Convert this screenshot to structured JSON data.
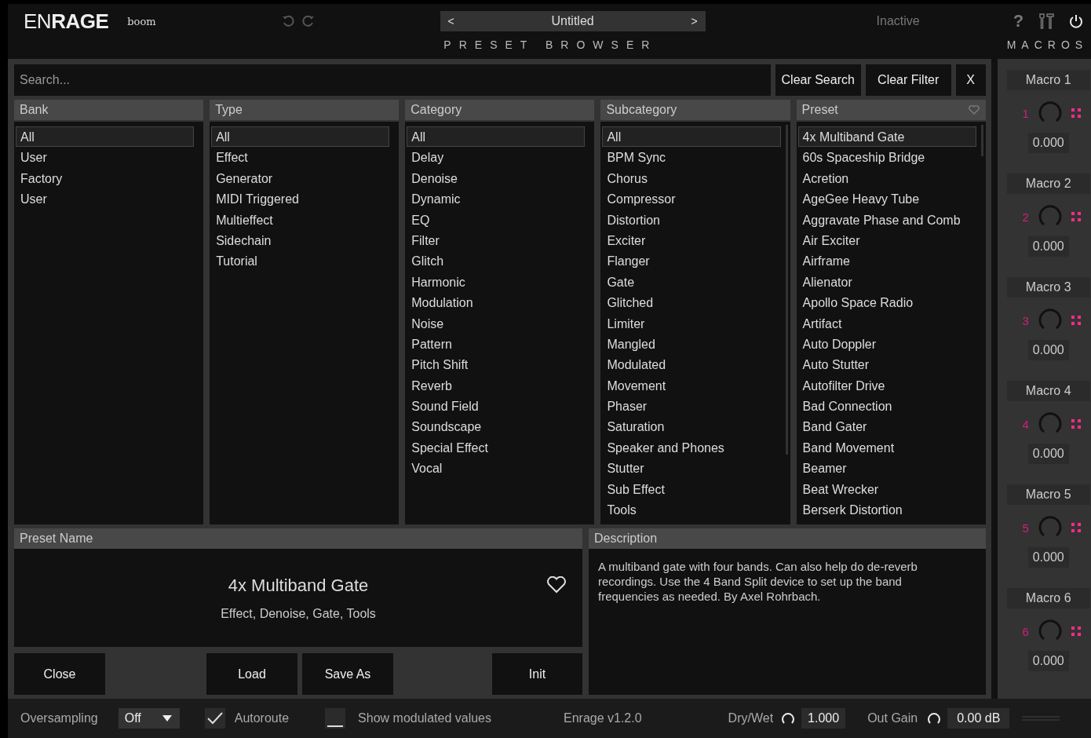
{
  "header": {
    "logo_light": "EN",
    "logo_bold": "RAGE",
    "brand": "boom",
    "preset_title": "Untitled",
    "prev": "<",
    "next": ">",
    "status": "Inactive",
    "help": "?",
    "section_title": "PRESET BROWSER",
    "macros_title": "MACROS"
  },
  "search": {
    "placeholder": "Search...",
    "buttons": [
      "Clear Search",
      "Clear Filter",
      "X"
    ]
  },
  "columns": [
    {
      "header": "Bank",
      "items": [
        {
          "label": "All",
          "selected": true
        },
        {
          "label": "User",
          "selected": false
        },
        {
          "label": "Factory",
          "selected": false
        },
        {
          "label": "User",
          "selected": false
        }
      ]
    },
    {
      "header": "Type",
      "items": [
        {
          "label": "All",
          "selected": true
        },
        {
          "label": "Effect",
          "selected": false
        },
        {
          "label": "Generator",
          "selected": false
        },
        {
          "label": "MIDI Triggered",
          "selected": false
        },
        {
          "label": "Multieffect",
          "selected": false
        },
        {
          "label": "Sidechain",
          "selected": false
        },
        {
          "label": "Tutorial",
          "selected": false
        }
      ]
    },
    {
      "header": "Category",
      "items": [
        {
          "label": "All",
          "selected": true
        },
        {
          "label": "Delay",
          "selected": false
        },
        {
          "label": "Denoise",
          "selected": false
        },
        {
          "label": "Dynamic",
          "selected": false
        },
        {
          "label": "EQ",
          "selected": false
        },
        {
          "label": "Filter",
          "selected": false
        },
        {
          "label": "Glitch",
          "selected": false
        },
        {
          "label": "Harmonic",
          "selected": false
        },
        {
          "label": "Modulation",
          "selected": false
        },
        {
          "label": "Noise",
          "selected": false
        },
        {
          "label": "Pattern",
          "selected": false
        },
        {
          "label": "Pitch Shift",
          "selected": false
        },
        {
          "label": "Reverb",
          "selected": false
        },
        {
          "label": "Sound Field",
          "selected": false
        },
        {
          "label": "Soundscape",
          "selected": false
        },
        {
          "label": "Special Effect",
          "selected": false
        },
        {
          "label": "Vocal",
          "selected": false
        }
      ]
    },
    {
      "header": "Subcategory",
      "items": [
        {
          "label": "All",
          "selected": true
        },
        {
          "label": "BPM Sync",
          "selected": false
        },
        {
          "label": "Chorus",
          "selected": false
        },
        {
          "label": "Compressor",
          "selected": false
        },
        {
          "label": "Distortion",
          "selected": false
        },
        {
          "label": "Exciter",
          "selected": false
        },
        {
          "label": "Flanger",
          "selected": false
        },
        {
          "label": "Gate",
          "selected": false
        },
        {
          "label": "Glitched",
          "selected": false
        },
        {
          "label": "Limiter",
          "selected": false
        },
        {
          "label": "Mangled",
          "selected": false
        },
        {
          "label": "Modulated",
          "selected": false
        },
        {
          "label": "Movement",
          "selected": false
        },
        {
          "label": "Phaser",
          "selected": false
        },
        {
          "label": "Saturation",
          "selected": false
        },
        {
          "label": "Speaker and Phones",
          "selected": false
        },
        {
          "label": "Stutter",
          "selected": false
        },
        {
          "label": "Sub Effect",
          "selected": false
        },
        {
          "label": "Tools",
          "selected": false
        }
      ]
    },
    {
      "header": "Preset",
      "items": [
        {
          "label": "4x Multiband Gate",
          "selected": true
        },
        {
          "label": "60s Spaceship Bridge",
          "selected": false
        },
        {
          "label": "Acretion",
          "selected": false
        },
        {
          "label": "AgeGee Heavy Tube",
          "selected": false
        },
        {
          "label": "Aggravate Phase and Comb",
          "selected": false
        },
        {
          "label": "Air Exciter",
          "selected": false
        },
        {
          "label": "Airframe",
          "selected": false
        },
        {
          "label": "Alienator",
          "selected": false
        },
        {
          "label": "Apollo Space Radio",
          "selected": false
        },
        {
          "label": "Artifact",
          "selected": false
        },
        {
          "label": "Auto Doppler",
          "selected": false
        },
        {
          "label": "Auto Stutter",
          "selected": false
        },
        {
          "label": "Autofilter Drive",
          "selected": false
        },
        {
          "label": "Bad Connection",
          "selected": false
        },
        {
          "label": "Band Gater",
          "selected": false
        },
        {
          "label": "Band Movement",
          "selected": false
        },
        {
          "label": "Beamer",
          "selected": false
        },
        {
          "label": "Beat Wrecker",
          "selected": false
        },
        {
          "label": "Berserk Distortion",
          "selected": false
        }
      ]
    }
  ],
  "preset_panel": {
    "header": "Preset Name",
    "name": "4x Multiband Gate",
    "tags": "Effect, Denoise, Gate, Tools"
  },
  "description": {
    "header": "Description",
    "text": "A multiband gate with four bands. Can also help do de-reverb recordings. Use the 4 Band Split device to set up the band frequencies as needed. By Axel Rohrbach."
  },
  "actions": [
    "Close",
    "Load",
    "Save As",
    "Init"
  ],
  "macros": [
    {
      "name": "Macro 1",
      "number": "1",
      "value": "0.000"
    },
    {
      "name": "Macro 2",
      "number": "2",
      "value": "0.000"
    },
    {
      "name": "Macro 3",
      "number": "3",
      "value": "0.000"
    },
    {
      "name": "Macro 4",
      "number": "4",
      "value": "0.000"
    },
    {
      "name": "Macro 5",
      "number": "5",
      "value": "0.000"
    },
    {
      "name": "Macro 6",
      "number": "6",
      "value": "0.000"
    }
  ],
  "footer": {
    "oversampling_label": "Oversampling",
    "oversampling_value": "Off",
    "autoroute": {
      "label": "Autoroute",
      "checked": true
    },
    "show_modulated": {
      "label": "Show modulated values",
      "checked": false
    },
    "version": "Enrage v1.2.0",
    "drywet_label": "Dry/Wet",
    "drywet_value": "1.000",
    "outgain_label": "Out Gain",
    "outgain_value": "0.00 dB"
  }
}
